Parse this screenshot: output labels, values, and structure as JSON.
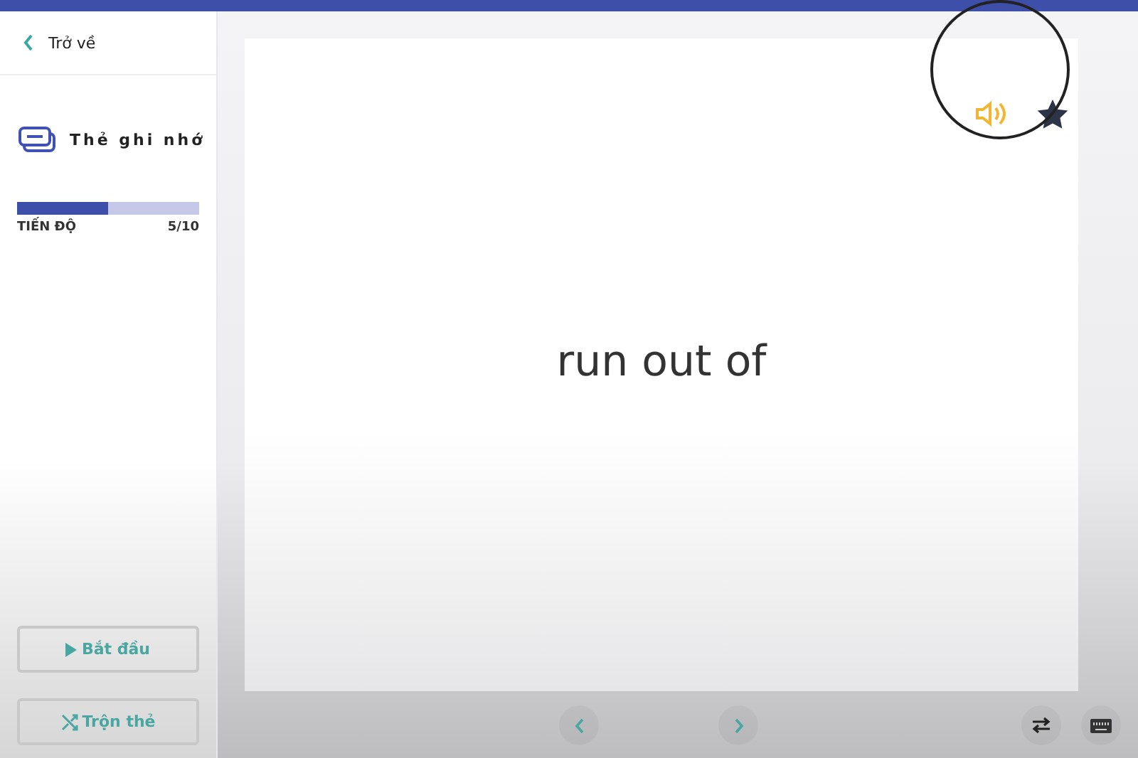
{
  "back_link": "Trở về",
  "deck": {
    "title": "Thẻ ghi nhớ"
  },
  "progress": {
    "label": "TIẾN ĐỘ",
    "count": "5/10",
    "level": 0.5
  },
  "sidebar_buttons": [
    {
      "kind": "start",
      "label": "Bắt đầu"
    },
    {
      "kind": "shuffle",
      "label": "Trộn thẻ"
    }
  ],
  "card": {
    "term": "run out of"
  }
}
